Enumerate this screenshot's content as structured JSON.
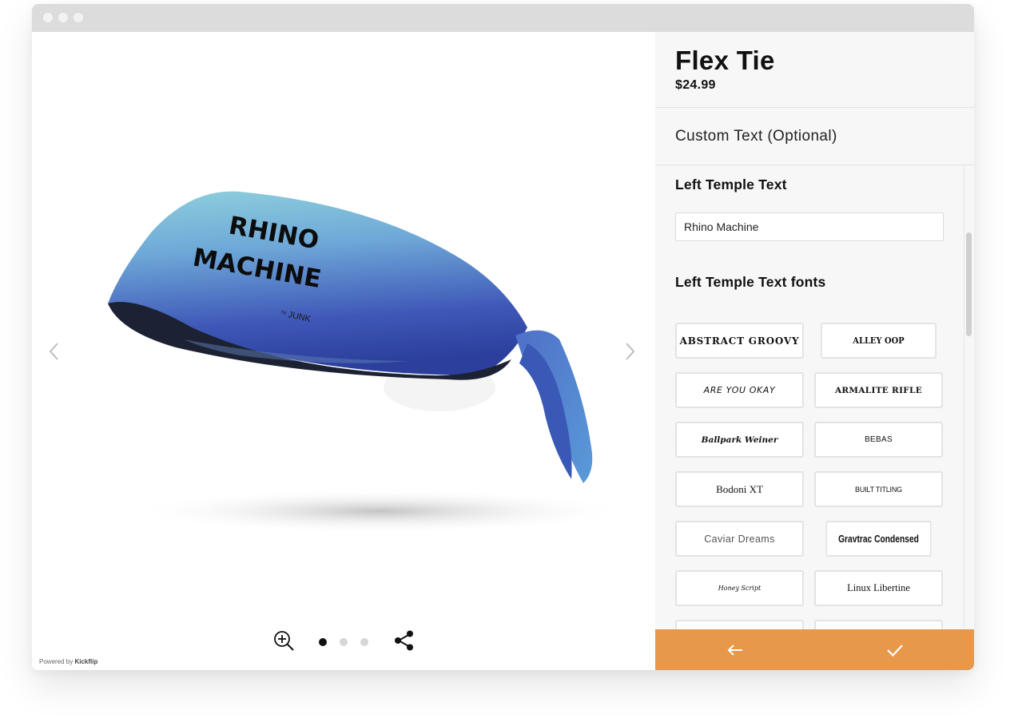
{
  "product": {
    "title": "Flex Tie",
    "price": "$24.99",
    "image_print_line1": "RHINO",
    "image_print_line2": "MACHINE",
    "brand_mark": "JUNK",
    "brand_prefix": "by"
  },
  "panel": {
    "section_title": "Custom Text (Optional)",
    "text_label": "Left Temple Text",
    "text_value": "Rhino Machine",
    "fonts_label": "Left Temple Text fonts",
    "fonts": [
      "ABSTRACT GROOVY",
      "ALLEY OOP",
      "ARE YOU OKAY",
      "ARMALITE RIFLE",
      "Ballpark Weiner",
      "BEBAS",
      "Bodoni XT",
      "BUILT TITLING",
      "Caviar Dreams",
      "Gravtrac Condensed",
      "Honey Script",
      "Linux Libertine"
    ]
  },
  "viewer": {
    "powered_by_prefix": "Powered by",
    "powered_by_brand": "Kickflip",
    "pager_active_index": 0,
    "pager_count": 3
  },
  "icons": {
    "prev": "chevron-left-icon",
    "next": "chevron-right-icon",
    "zoom": "zoom-in-icon",
    "share": "share-icon",
    "back": "arrow-left-icon",
    "confirm": "checkmark-icon"
  },
  "colors": {
    "accent": "#E7984A",
    "panel_bg": "#F7F7F7",
    "pager_active": "#111111",
    "pager_inactive": "#D6D6D6"
  }
}
